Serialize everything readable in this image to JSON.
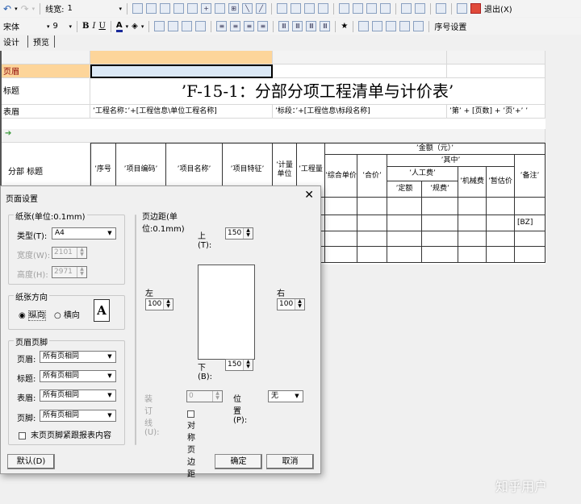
{
  "toolbar1": {
    "line_width_label": "线宽:",
    "line_width_value": "1",
    "exit_label": "退出(X)"
  },
  "toolbar2": {
    "font": "宋体",
    "font_size": "9",
    "bold": "B",
    "italic": "I",
    "underline": "U",
    "font_color": "A",
    "seq_setting": "序号设置"
  },
  "tabs": [
    {
      "label": "设计"
    },
    {
      "label": "预览"
    }
  ],
  "sheet": {
    "row_labels": {
      "header": "页眉",
      "title": "标题",
      "table_header": "表眉",
      "section": "分部 标题"
    },
    "title_text": "’F-15-1：分部分项工程清单与计价表’",
    "table_header_cells": [
      "’工程名称：’+[工程信息\\单位工程名称]",
      "’标段：’+[工程信息\\标段名称]",
      "’第’ + [页数] + ’页’+’ ’"
    ],
    "columns": [
      "’序号",
      "’项目编码’",
      "’项目名称’",
      "’项目特征’",
      "’计量单位",
      "’工程量",
      "’综合单价",
      "’合价’",
      "’人工费’",
      "’定额",
      "’规费’",
      "’机械费",
      "’暂估价",
      "’备注’"
    ],
    "amount_header": "’金额（元）’",
    "of_which": "’其中’",
    "remark_field": "[BZ]",
    "colors": {
      "selected_col": "#fdd59a",
      "active_cell": "#dce9f6",
      "header_label": "#8b0000"
    }
  },
  "dialog": {
    "title": "页面设置",
    "paper": {
      "group": "纸张(单位:0.1mm)",
      "type_label": "类型(T):",
      "type_value": "A4",
      "width_label": "宽度(W):",
      "width_value": "2101",
      "height_label": "高度(H):",
      "height_value": "2971"
    },
    "orientation": {
      "group": "纸张方向",
      "portrait": "纵向",
      "landscape": "横向",
      "selected": "portrait",
      "icon_letter": "A"
    },
    "hf": {
      "group": "页眉页脚",
      "header_label": "页眉:",
      "title_label": "标题:",
      "table_header_label": "表眉:",
      "footer_label": "页脚:",
      "value": "所有页相同",
      "last_page_label": "末页页脚紧跟报表内容",
      "last_page_checked": false
    },
    "margins": {
      "group": "页边距(单位:0.1mm)",
      "top_label": "上(T):",
      "top": "150",
      "left_label": "左(L):",
      "left": "100",
      "right_label": "右(R):",
      "right": "100",
      "bottom_label": "下(B):",
      "bottom": "150",
      "gutter_label": "装订线(U):",
      "gutter": "0",
      "position_label": "位置(P):",
      "position": "无",
      "mirror_label": "对称页边距",
      "mirror_checked": false
    },
    "buttons": {
      "default": "默认(D)",
      "ok": "确定",
      "cancel": "取消"
    }
  },
  "watermark": "知乎用户"
}
